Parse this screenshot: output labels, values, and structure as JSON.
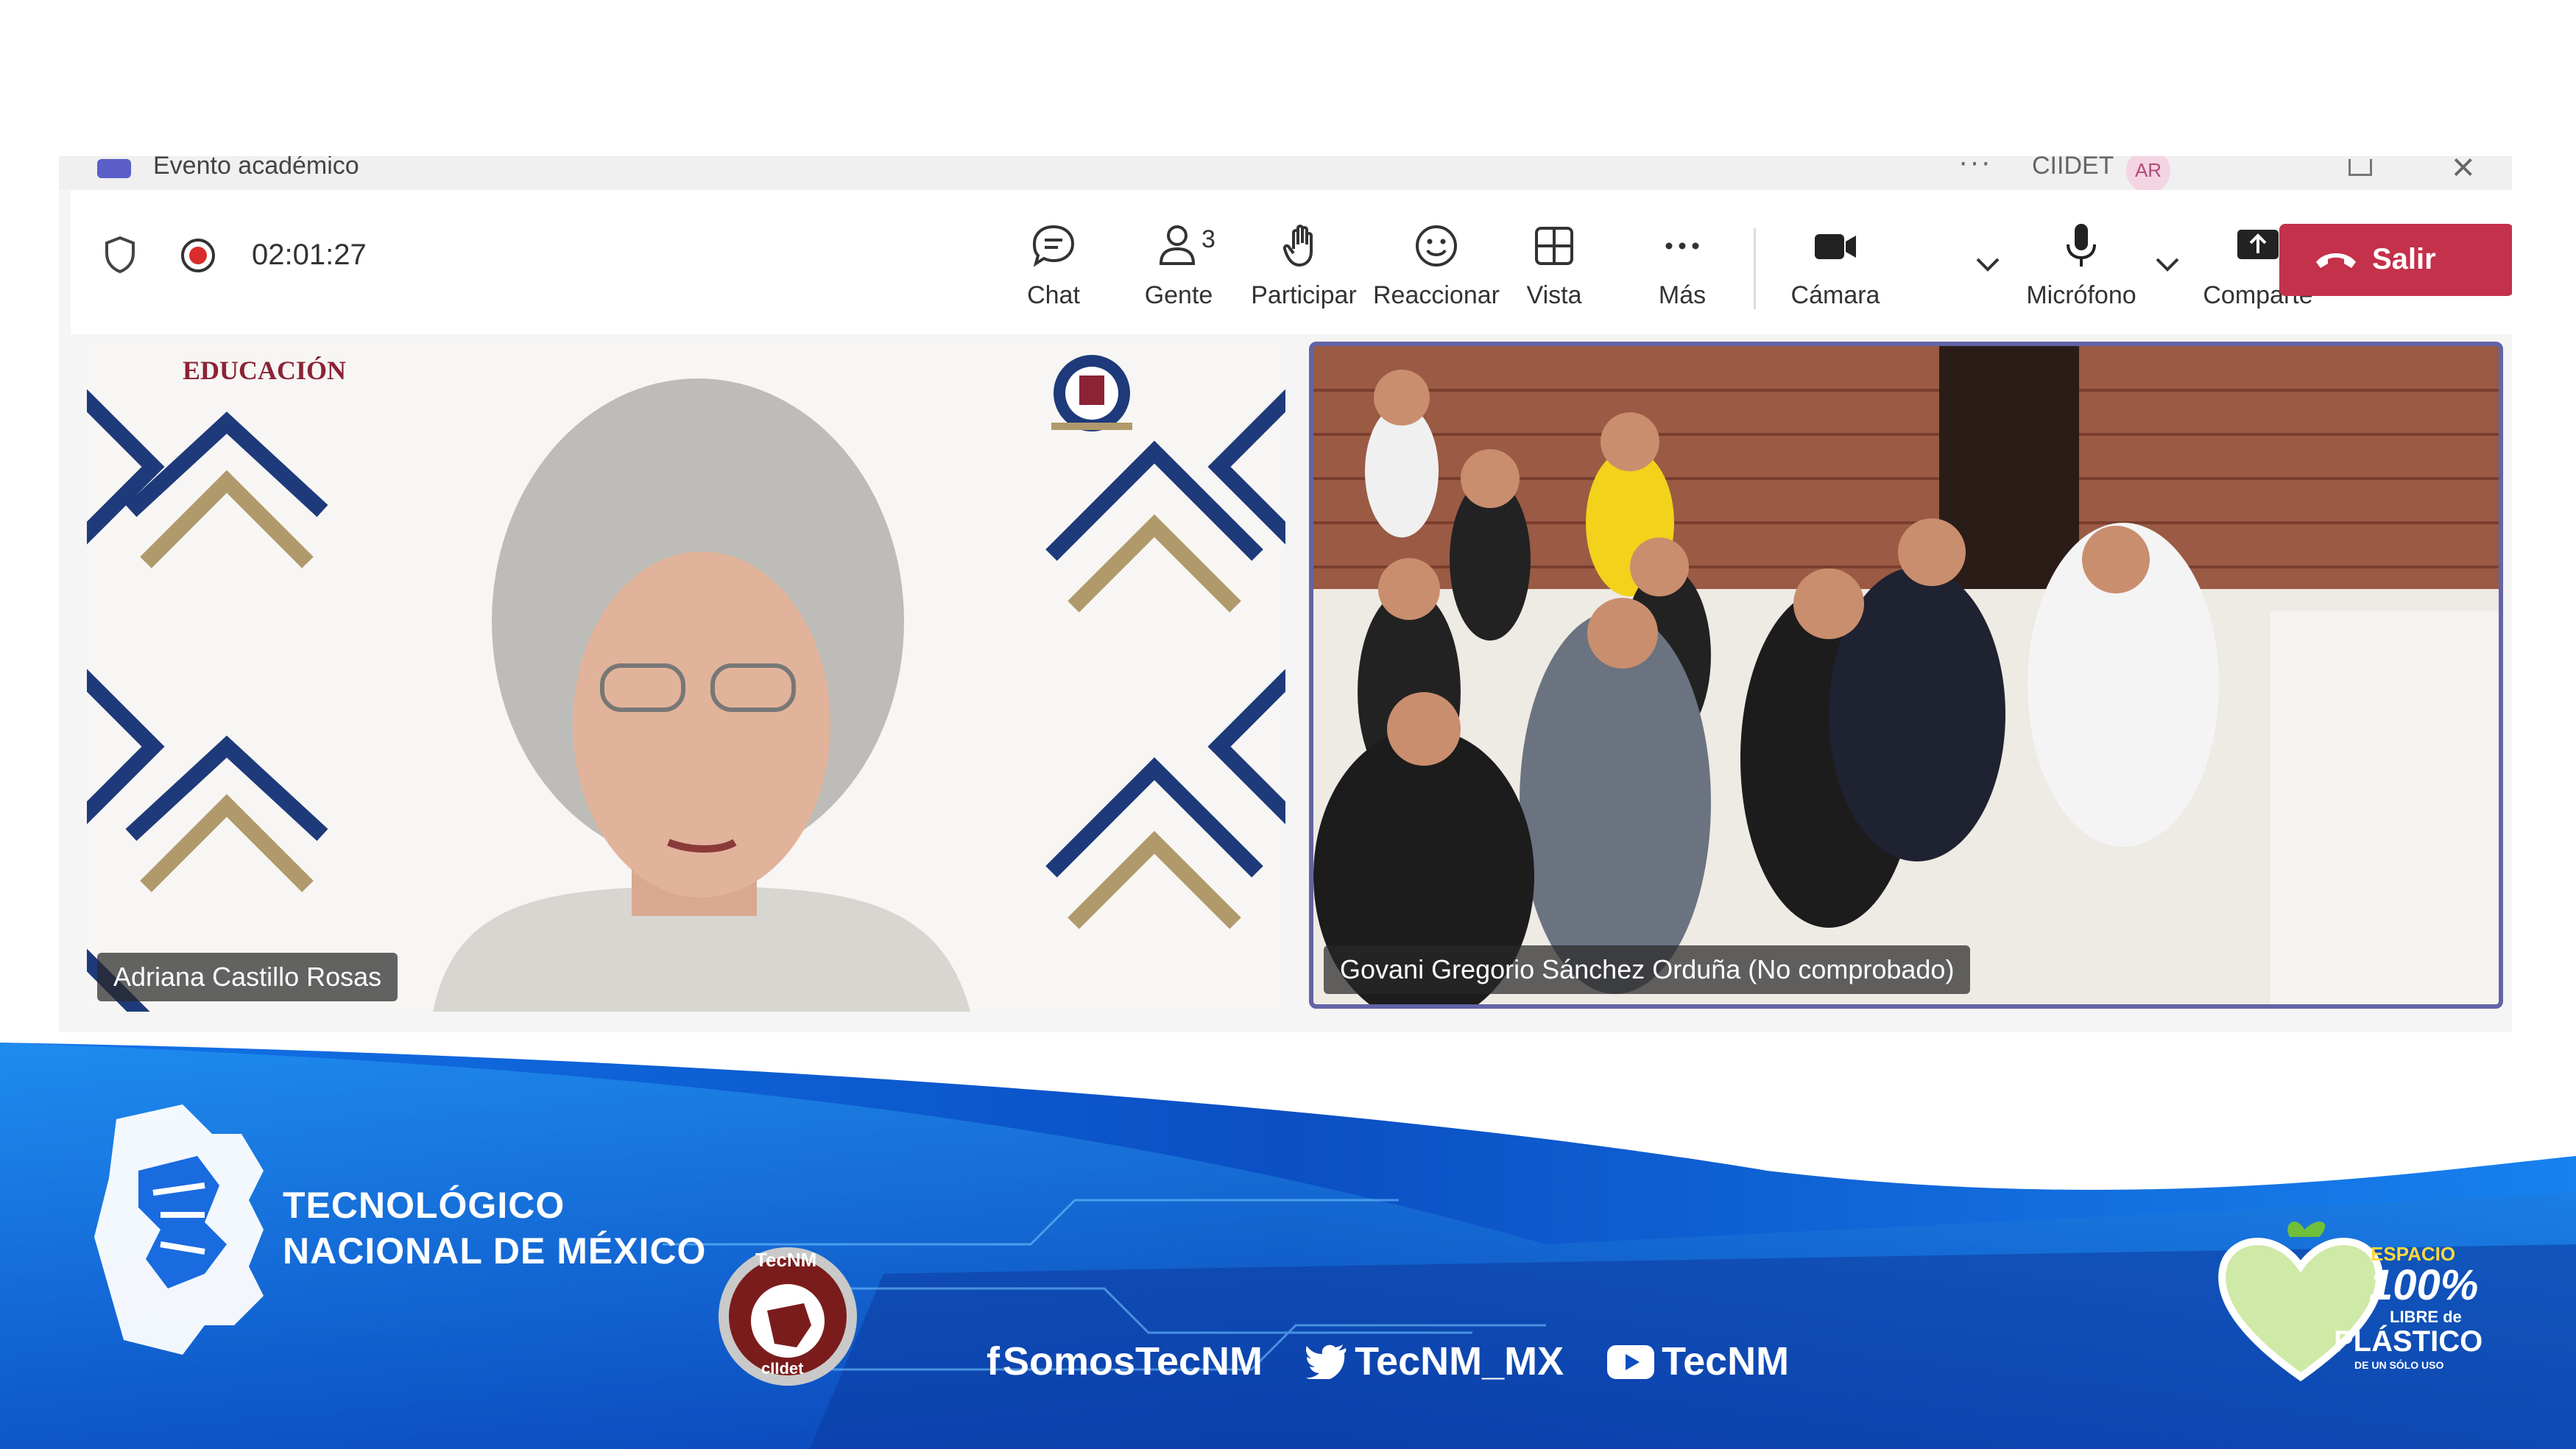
{
  "window": {
    "title": "Evento académico",
    "more": "···",
    "org": "CIIDET",
    "avatar_initials": "AR"
  },
  "toolbar": {
    "timer": "02:01:27",
    "people_count": "3",
    "buttons": [
      {
        "label": "Chat",
        "icon": "chat-icon"
      },
      {
        "label": "Gente",
        "icon": "people-icon"
      },
      {
        "label": "Participar",
        "icon": "raise-hand-icon"
      },
      {
        "label": "Reaccionar",
        "icon": "smiley-icon"
      },
      {
        "label": "Vista",
        "icon": "grid-icon"
      },
      {
        "label": "Más",
        "icon": "more-icon"
      },
      {
        "label": "Cámara",
        "icon": "camera-icon"
      },
      {
        "label": "Micrófono",
        "icon": "microphone-icon"
      },
      {
        "label": "Comparte",
        "icon": "share-icon"
      }
    ],
    "leave_label": "Salir"
  },
  "tiles": [
    {
      "name": "Adriana Castillo Rosas",
      "logo_text": "EDUCACIÓN"
    },
    {
      "name": "Govani Gregorio Sánchez Orduña (No comprobado)"
    }
  ],
  "banner": {
    "line1": "TECNOLÓGICO",
    "line2": "NACIONAL DE MÉXICO",
    "emblem_text": "TecNM",
    "emblem_sub": "cIIdet",
    "facebook": "SomosTecNM",
    "twitter": "TecNM_MX",
    "youtube": "TecNM",
    "espacio_line1": "ESPACIO",
    "espacio_line2": "100%",
    "espacio_line3": "LIBRE de",
    "espacio_line4": "PLÁSTICO",
    "espacio_line5": "DE UN SÓLO USO"
  },
  "colors": {
    "leave": "#c4314b",
    "accent": "#6264a7",
    "banner_blue": "#0b5fd6"
  }
}
